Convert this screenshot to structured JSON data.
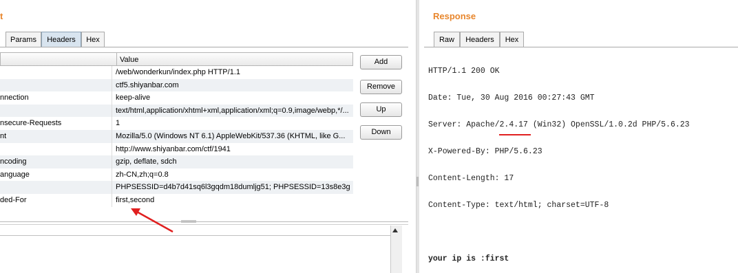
{
  "request": {
    "title": "t",
    "tabs": [
      "Params",
      "Headers",
      "Hex"
    ],
    "table": {
      "columns": [
        "",
        "Value"
      ],
      "rows": [
        {
          "name": "",
          "value": "/web/wonderkun/index.php HTTP/1.1"
        },
        {
          "name": "",
          "value": "ctf5.shiyanbar.com"
        },
        {
          "name": "nnection",
          "value": "keep-alive"
        },
        {
          "name": "",
          "value": "text/html,application/xhtml+xml,application/xml;q=0.9,image/webp,*/..."
        },
        {
          "name": "nsecure-Requests",
          "value": "1"
        },
        {
          "name": "nt",
          "value": "Mozilla/5.0 (Windows NT 6.1) AppleWebKit/537.36 (KHTML, like G..."
        },
        {
          "name": "",
          "value": "http://www.shiyanbar.com/ctf/1941"
        },
        {
          "name": "ncoding",
          "value": "gzip, deflate, sdch"
        },
        {
          "name": "anguage",
          "value": "zh-CN,zh;q=0.8"
        },
        {
          "name": "",
          "value": "PHPSESSID=d4b7d41sq6l3gqdm18dumljg51; PHPSESSID=13s8e3g..."
        },
        {
          "name": "ded-For",
          "value": "first,second"
        }
      ]
    },
    "buttons": {
      "add": "Add",
      "remove": "Remove",
      "up": "Up",
      "down": "Down"
    }
  },
  "response": {
    "title": "Response",
    "tabs": [
      "Raw",
      "Headers",
      "Hex"
    ],
    "lines": [
      "HTTP/1.1 200 OK",
      "Date: Tue, 30 Aug 2016 00:27:43 GMT",
      "Server: Apache/2.4.17 (Win32) OpenSSL/1.0.2d PHP/5.6.23",
      "X-Powered-By: PHP/5.6.23",
      "Content-Length: 17",
      "Content-Type: text/html; charset=UTF-8",
      "",
      "your ip is :first"
    ]
  },
  "annotation_color": "#e01f1f",
  "title_color": "#e8862c"
}
